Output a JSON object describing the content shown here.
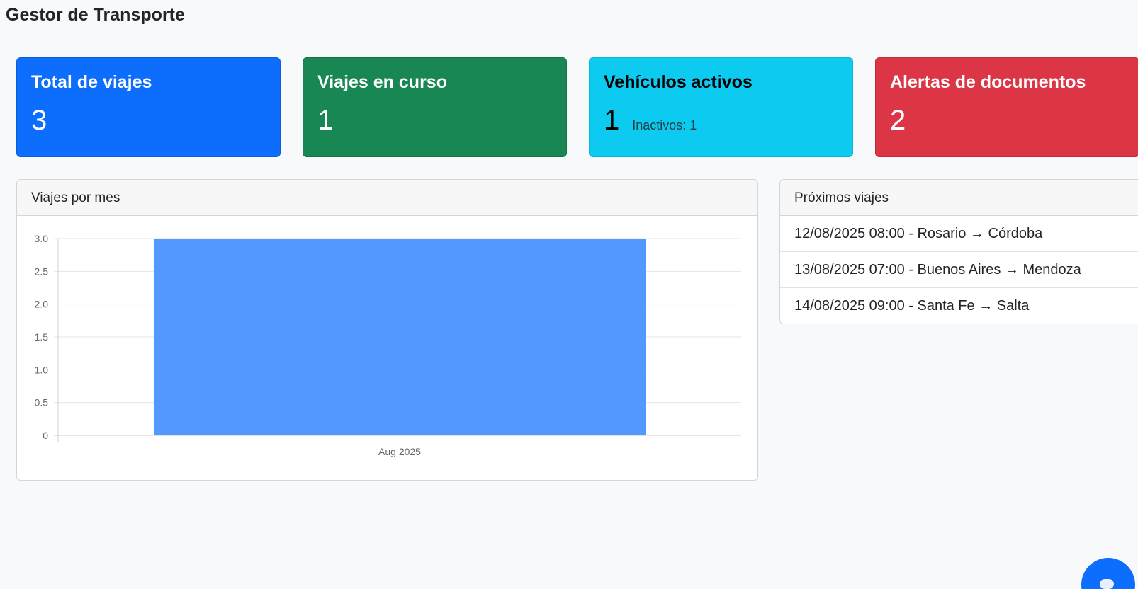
{
  "app": {
    "title": "Gestor de Transporte"
  },
  "stats": [
    {
      "title": "Total de viajes",
      "value": "3",
      "sub": "",
      "color": "#0d6efd"
    },
    {
      "title": "Viajes en curso",
      "value": "1",
      "sub": "",
      "color": "#198754"
    },
    {
      "title": "Vehículos activos",
      "value": "1",
      "sub": "Inactivos: 1",
      "color": "#0dcaf0"
    },
    {
      "title": "Alertas de documentos",
      "value": "2",
      "sub": "",
      "color": "#dc3545"
    }
  ],
  "chart_panel": {
    "title": "Viajes por mes"
  },
  "chart_data": {
    "type": "bar",
    "categories": [
      "Aug 2025"
    ],
    "values": [
      3
    ],
    "title": "",
    "xlabel": "",
    "ylabel": "",
    "ylim": [
      0,
      3
    ],
    "yticks": [
      "0",
      "0.5",
      "1.0",
      "1.5",
      "2.0",
      "2.5",
      "3.0"
    ],
    "grid": true,
    "bar_color": "#5398fe"
  },
  "trips_panel": {
    "title": "Próximos viajes",
    "items": [
      "12/08/2025 08:00 - Rosario → Córdoba",
      "13/08/2025 07:00 - Buenos Aires → Mendoza",
      "14/08/2025 09:00 - Santa Fe → Salta"
    ]
  },
  "fab": {
    "icon": "chat-icon",
    "color": "#0d6efd"
  }
}
